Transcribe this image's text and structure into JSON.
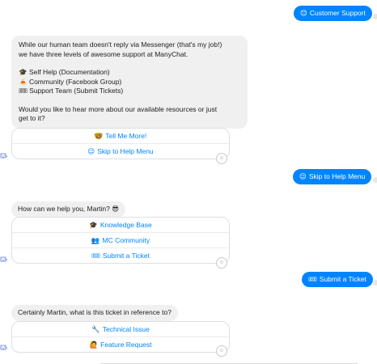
{
  "colors": {
    "messenger_blue": "#0084ff",
    "bot_bubble_bg": "#f1f0f0",
    "link_blue": "#0084ff"
  },
  "messages": {
    "user1": {
      "emoji": "😊",
      "text": "Customer Support"
    },
    "bot1": {
      "lines": [
        "While our human team doesn't reply via Messenger (that's my job!)",
        "we have three levels of awesome support at ManyChat.",
        "",
        "🎓 Self Help (Documentation)",
        "🍝 Community (Facebook Group)",
        "🎟 Support Team (Submit Tickets)",
        "",
        "Would you like to hear more about our available resources or just",
        "get to it?"
      ],
      "buttons": [
        {
          "emoji": "🤓",
          "label": "Tell Me More!"
        },
        {
          "emoji": "😉",
          "label": "Skip to Help Menu"
        }
      ]
    },
    "user2": {
      "emoji": "😉",
      "text": "Skip to Help Menu"
    },
    "bot2": {
      "text": "How can we help you, Martin? 😎",
      "buttons": [
        {
          "emoji": "🎓",
          "label": "Knowledge Base"
        },
        {
          "emoji": "👥",
          "label": "MC Community"
        },
        {
          "emoji": "🎟",
          "label": "Submit a Ticket"
        }
      ]
    },
    "user3": {
      "emoji": "🎟",
      "text": "Submit a Ticket"
    },
    "bot3": {
      "text": "Certainly Martin, what is this ticket in reference to?",
      "buttons": [
        {
          "emoji": "🔧",
          "label": "Technical Issue"
        },
        {
          "emoji": "🙋",
          "label": "Feature Request"
        }
      ]
    }
  },
  "icons": {
    "bot_avatar": "bot-avatar-icon",
    "reaction": "add-reaction-icon",
    "read_receipt": "read-receipt-dot"
  }
}
